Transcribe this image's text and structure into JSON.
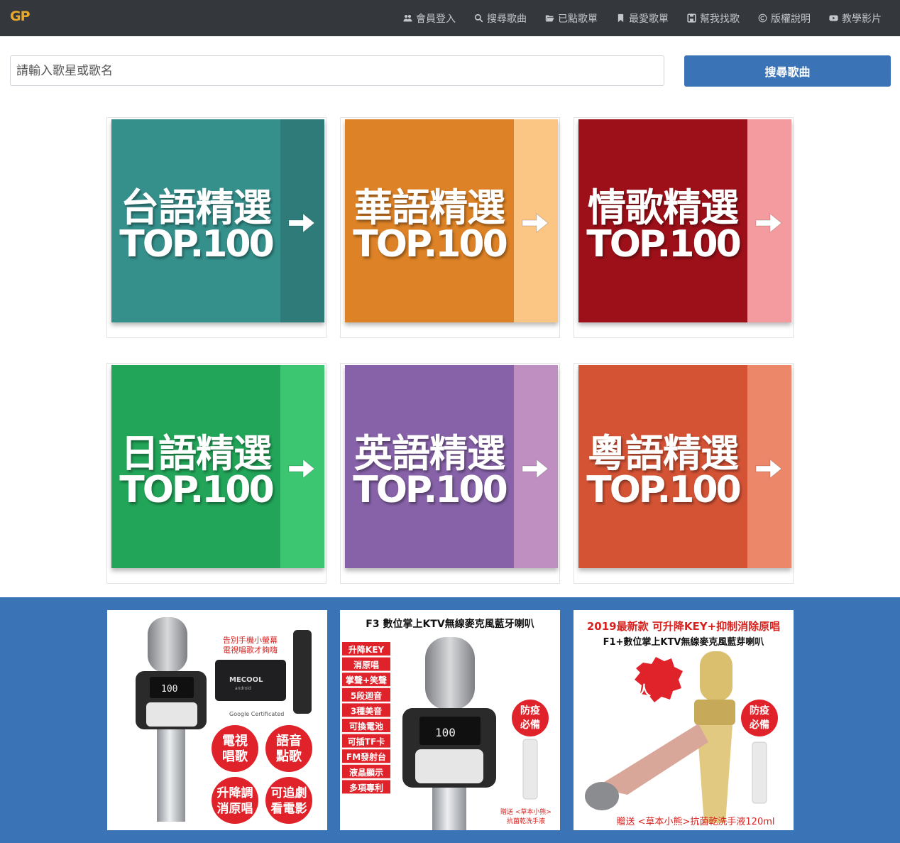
{
  "brand": {
    "logo": "GP"
  },
  "nav": {
    "items": [
      {
        "label": "會員登入",
        "icon": "users-icon"
      },
      {
        "label": "搜尋歌曲",
        "icon": "search-icon"
      },
      {
        "label": "已點歌單",
        "icon": "folder-open-icon"
      },
      {
        "label": "最愛歌單",
        "icon": "bookmark-icon"
      },
      {
        "label": "幫我找歌",
        "icon": "save-icon"
      },
      {
        "label": "版權說明",
        "icon": "copyright-icon"
      },
      {
        "label": "教學影片",
        "icon": "youtube-icon"
      }
    ]
  },
  "search": {
    "placeholder": "請輸入歌星或歌名",
    "value": "",
    "button_label": "搜尋歌曲"
  },
  "tiles": [
    {
      "title": "台語精選",
      "subtitle": "TOP.100",
      "color": "#35908c",
      "stripe": "#2f7b79"
    },
    {
      "title": "華語精選",
      "subtitle": "TOP.100",
      "color": "#dd8226",
      "stripe": "#fbc583"
    },
    {
      "title": "情歌精選",
      "subtitle": "TOP.100",
      "color": "#9e1019",
      "stripe": "#f39b9e"
    },
    {
      "title": "日語精選",
      "subtitle": "TOP.100",
      "color": "#22a559",
      "stripe": "#3cc672"
    },
    {
      "title": "英語精選",
      "subtitle": "TOP.100",
      "color": "#8762a8",
      "stripe": "#bf8fc1"
    },
    {
      "title": "粵語精選",
      "subtitle": "TOP.100",
      "color": "#d45335",
      "stripe": "#ec8769"
    }
  ],
  "ads": [
    {
      "callout": "告別手機小螢幕\n電視唱歌才夠嗨",
      "box_brand": "MECOOL",
      "box_sub": "android",
      "certified": "Google Certificated",
      "display": "100",
      "badges": [
        "電視\n唱歌",
        "語音\n點歌",
        "升降調\n消原唱",
        "可追劇\n看電影"
      ]
    },
    {
      "heading": "F3 數位掌上KTV無線麥克風藍牙喇叭",
      "features": [
        "升降KEY",
        "消原唱",
        "掌聲+笑聲",
        "5段迴音",
        "3種美音",
        "可換電池",
        "可插TF卡",
        "FM發射台",
        "液晶顯示",
        "多項專利"
      ],
      "badge": "防疫\n必備",
      "gift": "贈送 <草本小熊>\n抗菌乾洗手液",
      "display": "100"
    },
    {
      "heading": "2019最新款 可升降KEY+抑制消除原唱",
      "subheading": "F1+數位掌上KTV無線麥克風藍芽喇叭",
      "badge_left": "雙人\n歡唱",
      "badge_right": "防疫\n必備",
      "gift": "贈送 <草本小熊>抗菌乾洗手液120ml"
    }
  ]
}
